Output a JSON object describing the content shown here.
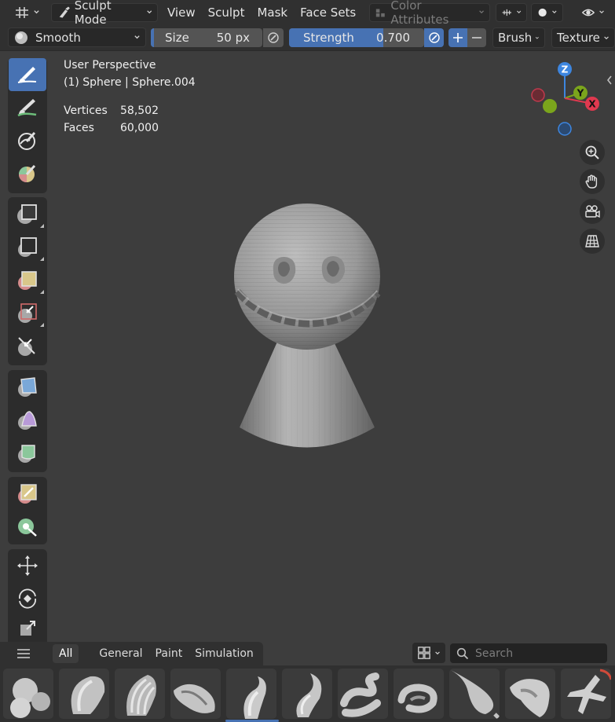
{
  "header": {
    "mode_label": "Sculpt Mode",
    "menus": [
      "View",
      "Sculpt",
      "Mask",
      "Face Sets"
    ],
    "color_attributes_label": "Color Attributes"
  },
  "tool_settings": {
    "brush_name": "Smooth",
    "size_label": "Size",
    "size_value": "50 px",
    "strength_label": "Strength",
    "strength_value": "0.700",
    "strength_fraction": 0.7,
    "brush_menu": "Brush",
    "texture_menu": "Texture"
  },
  "viewport": {
    "view_name": "User Perspective",
    "object_info": "(1) Sphere | Sphere.004",
    "stats": [
      {
        "label": "Vertices",
        "value": "58,502"
      },
      {
        "label": "Faces",
        "value": "60,000"
      }
    ]
  },
  "gizmo": {
    "axes": {
      "z": "Z",
      "y": "Y",
      "x": "X"
    },
    "colors": {
      "x": "#e0394f",
      "y": "#7ba51c",
      "z": "#3d86e0"
    }
  },
  "asset_shelf": {
    "tabs": [
      "All",
      "General",
      "Paint",
      "Simulation"
    ],
    "active_tab": "All",
    "search_placeholder": "Search"
  },
  "colors": {
    "accent": "#4772b3",
    "header_bg": "#303030",
    "viewport_bg": "#3d3d3d"
  }
}
